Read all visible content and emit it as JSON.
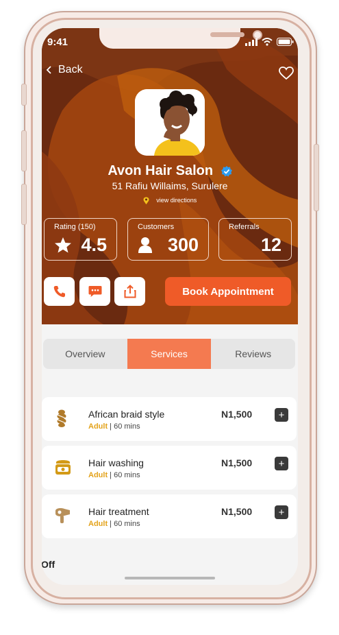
{
  "status_bar": {
    "time": "9:41"
  },
  "nav": {
    "back_label": "Back"
  },
  "salon": {
    "name": "Avon Hair Salon",
    "address": "51 Rafiu Willaims, Surulere",
    "directions_label": "view directions"
  },
  "stats": {
    "rating": {
      "label": "Rating (150)",
      "value": "4.5"
    },
    "customers": {
      "label": "Customers",
      "value": "300"
    },
    "referrals": {
      "label": "Referrals",
      "value": "12"
    }
  },
  "actions": {
    "book_label": "Book Appointment"
  },
  "tabs": [
    {
      "label": "Overview",
      "active": false
    },
    {
      "label": "Services",
      "active": true
    },
    {
      "label": "Reviews",
      "active": false
    }
  ],
  "services": [
    {
      "name": "African braid style",
      "category": "Adult",
      "duration": "| 60 mins",
      "price": "N1,500",
      "add_label": "+",
      "icon": "braid-icon"
    },
    {
      "name": "Hair washing",
      "category": "Adult",
      "duration": "| 60 mins",
      "price": "N1,500",
      "add_label": "+",
      "icon": "hair-wash-icon"
    },
    {
      "name": "Hair treatment",
      "category": "Adult",
      "duration": "| 60 mins",
      "price": "N1,500",
      "add_label": "+",
      "icon": "hair-dryer-icon"
    }
  ],
  "offers_peek": "Off",
  "colors": {
    "hero_bg": "#6a2a10",
    "accent": "#ef5b28",
    "tab_active": "#f47a50",
    "category": "#e3a21a",
    "verified": "#2b9bf0"
  }
}
